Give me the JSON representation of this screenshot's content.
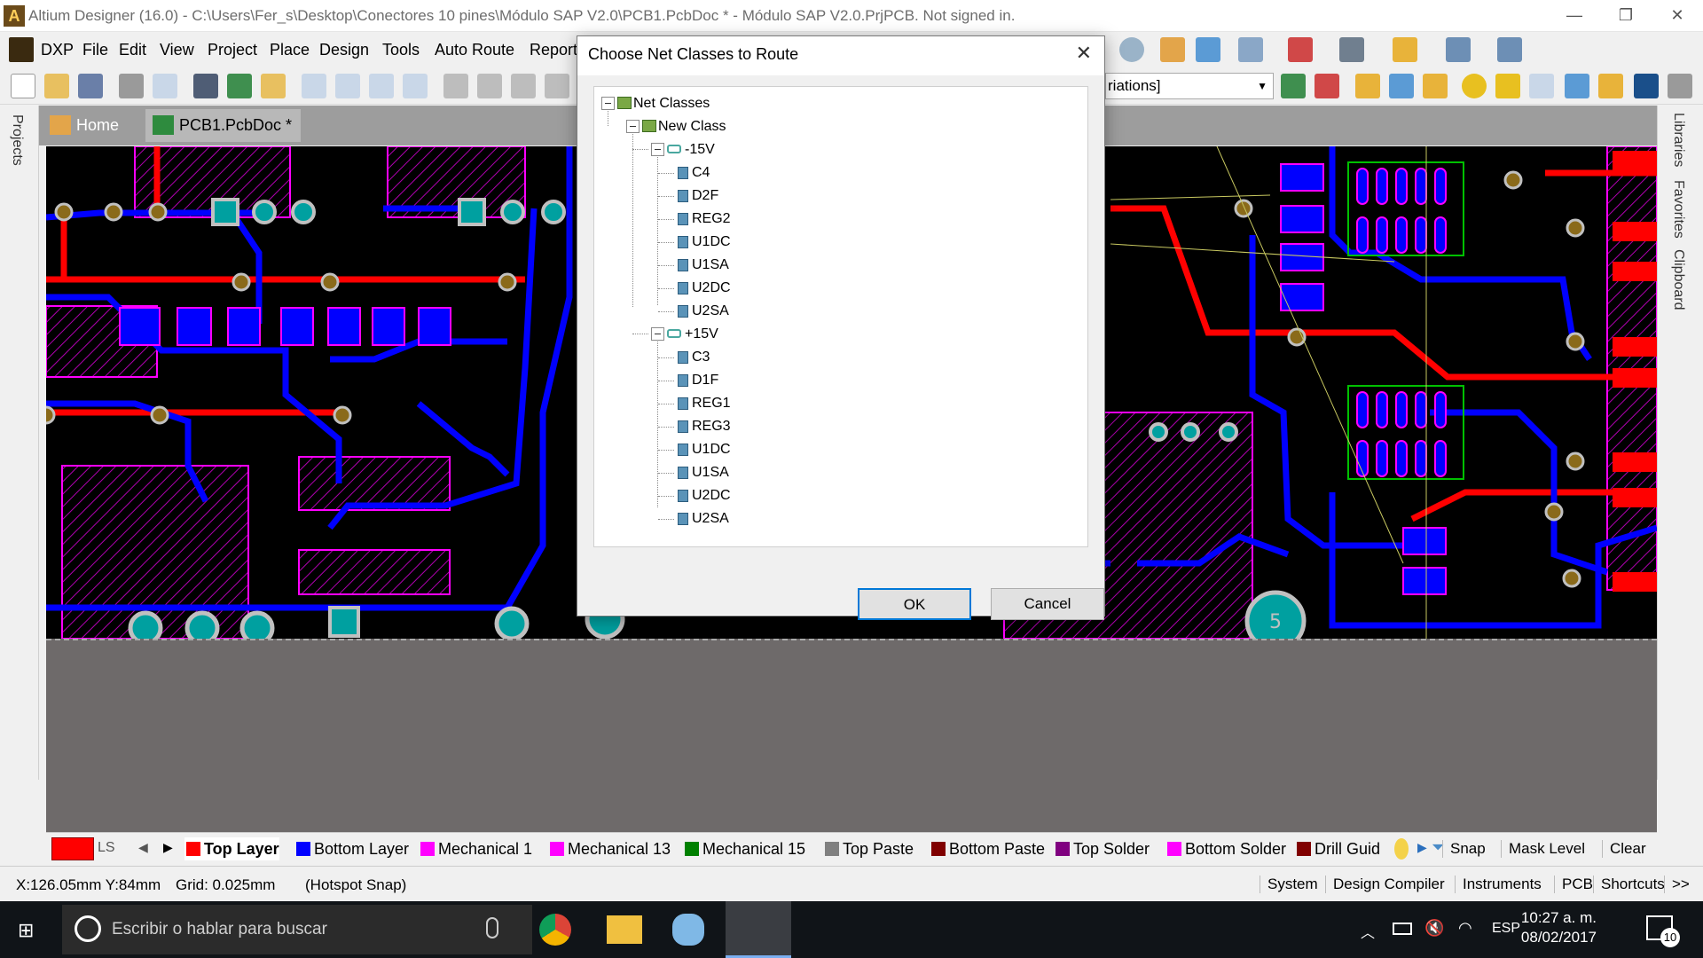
{
  "window": {
    "title": "Altium Designer (16.0) - C:\\Users\\Fer_s\\Desktop\\Conectores 10 pines\\Módulo SAP V2.0\\PCB1.PcbDoc * - Módulo SAP V2.0.PrjPCB. Not signed in.",
    "minimize": "—",
    "restore": "❐",
    "close": "✕"
  },
  "menu": [
    "DXP",
    "File",
    "Edit",
    "View",
    "Project",
    "Place",
    "Design",
    "Tools",
    "Auto Route",
    "Report"
  ],
  "variations_combo": "riations]",
  "tabs": [
    {
      "label": "Home",
      "icon": "home-icon"
    },
    {
      "label": "PCB1.PcbDoc *",
      "icon": "pcb-doc-icon"
    }
  ],
  "left_panel": {
    "label": "Projects"
  },
  "right_panels": [
    "Libraries",
    "Favorites",
    "Clipboard"
  ],
  "canvas": {
    "pad_label": "5"
  },
  "layers": {
    "current_indicator": "LS",
    "items": [
      {
        "label": "Top Layer",
        "color": "#ff0000",
        "active": true
      },
      {
        "label": "Bottom Layer",
        "color": "#0000ff"
      },
      {
        "label": "Mechanical 1",
        "color": "#ff00ff"
      },
      {
        "label": "Mechanical 13",
        "color": "#ff00ff"
      },
      {
        "label": "Mechanical 15",
        "color": "#008000"
      },
      {
        "label": "Top Paste",
        "color": "#808080"
      },
      {
        "label": "Bottom Paste",
        "color": "#800000"
      },
      {
        "label": "Top Solder",
        "color": "#800080"
      },
      {
        "label": "Bottom Solder",
        "color": "#ff00ff"
      },
      {
        "label": "Drill Guid",
        "color": "#800000"
      }
    ],
    "snap": "Snap",
    "mask_level": "Mask Level",
    "clear": "Clear"
  },
  "status": {
    "coords": "X:126.05mm Y:84mm",
    "grid": "Grid: 0.025mm",
    "snap_mode": "(Hotspot Snap)",
    "panels": [
      "System",
      "Design Compiler",
      "Instruments",
      "PCB",
      "Shortcuts",
      ">>"
    ]
  },
  "taskbar": {
    "search_placeholder": "Escribir o hablar para buscar",
    "lang": "ESP",
    "time": "10:27 a. m.",
    "date": "08/02/2017",
    "notifications": "10"
  },
  "dialog": {
    "title": "Choose Net Classes to Route",
    "ok": "OK",
    "cancel": "Cancel",
    "tree": {
      "root": "Net Classes",
      "class": "New Class",
      "groups": [
        {
          "name": "-15V",
          "items": [
            "C4",
            "D2F",
            "REG2",
            "U1DC",
            "U1SA",
            "U2DC",
            "U2SA"
          ]
        },
        {
          "name": "+15V",
          "items": [
            "C3",
            "D1F",
            "REG1",
            "REG3",
            "U1DC",
            "U1SA",
            "U2DC",
            "U2SA"
          ]
        }
      ]
    }
  },
  "colors": {
    "top_layer": "#ff0000",
    "bottom_layer": "#0000ff",
    "pad": "#00a0a0",
    "via_ring": "#c0c0c0",
    "component_hatch": "#ff00ff",
    "canvas_bg": "#000000"
  }
}
